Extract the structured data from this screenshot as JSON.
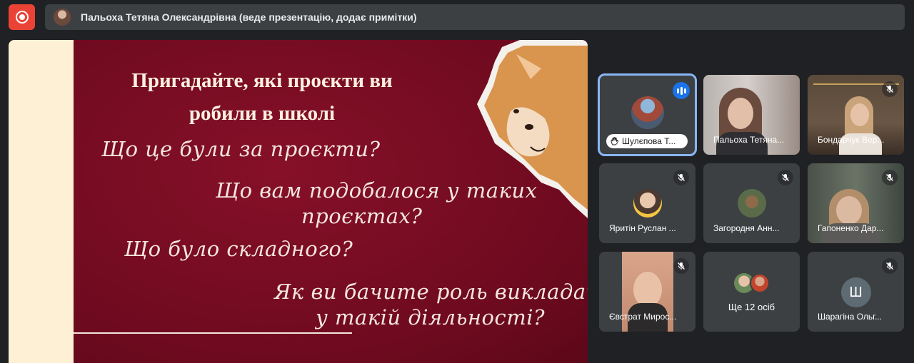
{
  "presenter": {
    "label": "Пальоха Тетяна Олександрівна (веде презентацію, додає примітки)"
  },
  "slide": {
    "title_line1": "Пригадайте, які проєкти ви",
    "title_line2": "робили в школі",
    "questions": [
      "Що це були за проєкти?",
      "Що вам подобалося у таких",
      "проєктах?",
      "Що було складного?",
      "Як ви бачите роль викладача",
      "у такій діяльності?"
    ],
    "colors": {
      "background": "#7a0c22",
      "accent_band": "#fdf0d5",
      "text": "#f3e6df"
    }
  },
  "participants": [
    {
      "name": "Шулєпова Т...",
      "state": "speaking",
      "icon": "speaking-icon"
    },
    {
      "name": "Пальоха Тетяна...",
      "state": "video"
    },
    {
      "name": "Бондарчук Вер...",
      "state": "video-muted",
      "icon": "mic-off-icon"
    },
    {
      "name": "Яритін Руслан ...",
      "state": "avatar-muted",
      "icon": "mic-off-icon"
    },
    {
      "name": "Загородня Анн...",
      "state": "avatar-muted",
      "icon": "mic-off-icon"
    },
    {
      "name": "Гапоненко Дар...",
      "state": "video-muted",
      "icon": "mic-off-icon"
    },
    {
      "name": "Євстрат Мирос...",
      "state": "video-muted",
      "icon": "mic-off-icon"
    },
    {
      "name": "",
      "state": "more",
      "more_label": "Ще 12 осіб"
    },
    {
      "name": "Шарагіна Ольг...",
      "state": "letter-muted",
      "letter": "Ш",
      "icon": "mic-off-icon"
    }
  ]
}
